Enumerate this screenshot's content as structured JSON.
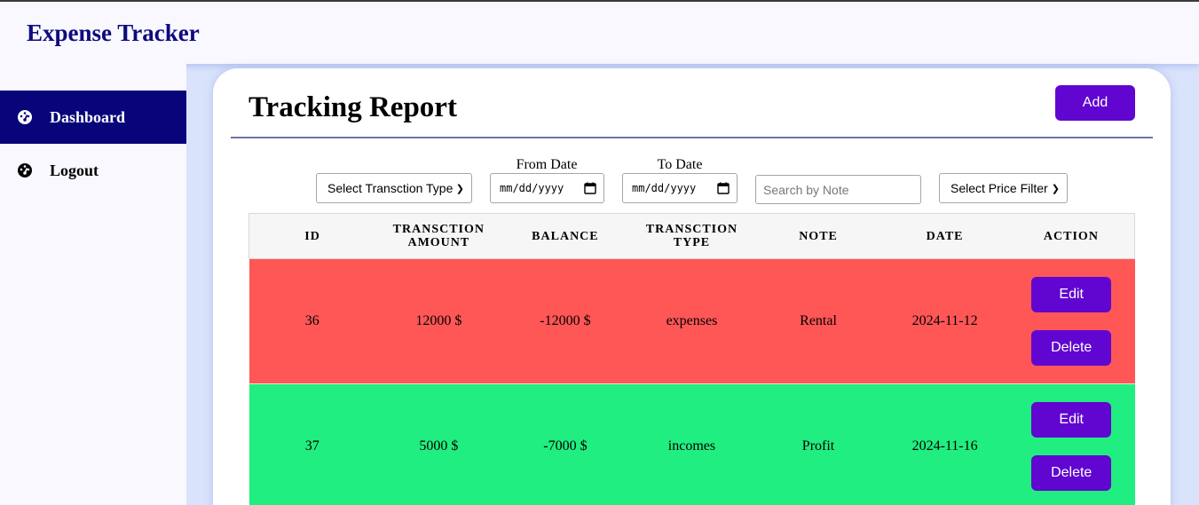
{
  "app": {
    "title": "Expense Tracker"
  },
  "sidebar": {
    "items": [
      {
        "label": "Dashboard",
        "icon": "dashboard-gauge-icon",
        "active": true
      },
      {
        "label": "Logout",
        "icon": "dashboard-gauge-icon",
        "active": false
      }
    ]
  },
  "page": {
    "title": "Tracking Report",
    "add_label": "Add"
  },
  "filters": {
    "type_select": "Select Transction Type",
    "from_label": "From Date",
    "from_value": "mm/dd/yyyy",
    "to_label": "To Date",
    "to_value": "mm/dd/yyyy",
    "search_placeholder": "Search by Note",
    "price_select": "Select Price Filter"
  },
  "table": {
    "headers": [
      {
        "line1": "ID",
        "line2": ""
      },
      {
        "line1": "Transction",
        "line2": "Amount"
      },
      {
        "line1": "Balance",
        "line2": ""
      },
      {
        "line1": "Transction",
        "line2": "Type"
      },
      {
        "line1": "Note",
        "line2": ""
      },
      {
        "line1": "Date",
        "line2": ""
      },
      {
        "line1": "Action",
        "line2": ""
      }
    ],
    "rows": [
      {
        "id": "36",
        "amount": "12000 $",
        "balance": "-12000 $",
        "type": "expenses",
        "note": "Rental",
        "date": "2024-11-12",
        "edit": "Edit",
        "delete": "Delete",
        "row_color": "#ff5656"
      },
      {
        "id": "37",
        "amount": "5000 $",
        "balance": "-7000 $",
        "type": "incomes",
        "note": "Profit",
        "date": "2024-11-16",
        "edit": "Edit",
        "delete": "Delete",
        "row_color": "#21ee80"
      }
    ]
  },
  "colors": {
    "brand": "#0f0a7e",
    "sidebar_active": "#08057a",
    "button": "#6006d0",
    "expense_row": "#ff5656",
    "income_row": "#21ee80"
  }
}
